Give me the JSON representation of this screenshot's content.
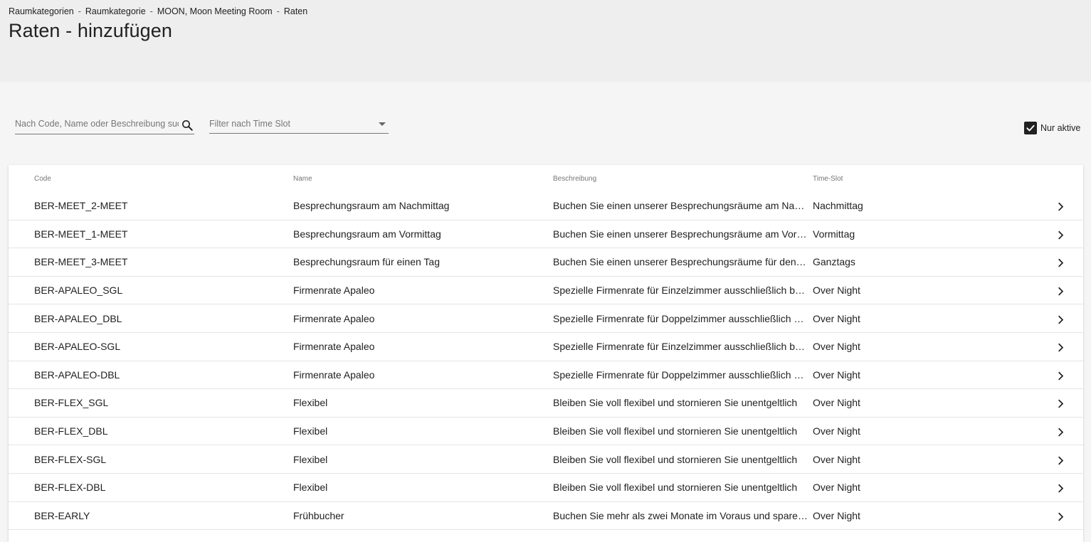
{
  "breadcrumb": [
    {
      "label": "Raumkategorien"
    },
    {
      "label": "Raumkategorie"
    },
    {
      "label": "MOON, Moon Meeting Room"
    },
    {
      "label": "Raten"
    }
  ],
  "breadcrumb_separator": "-",
  "page_title": "Raten - hinzufügen",
  "search": {
    "placeholder": "Nach Code, Name oder Beschreibung suchen",
    "value": ""
  },
  "filter": {
    "placeholder": "Filter nach Time Slot"
  },
  "active_filter": {
    "label": "Nur aktive",
    "checked": true
  },
  "table": {
    "columns": {
      "code": "Code",
      "name": "Name",
      "description": "Beschreibung",
      "time_slot": "Time-Slot"
    },
    "rows": [
      {
        "code": "BER-MEET_2-MEET",
        "name": "Besprechungsraum am Nachmittag",
        "description": "Buchen Sie einen unserer Besprechungsräume am Nachmittag",
        "time_slot": "Nachmittag"
      },
      {
        "code": "BER-MEET_1-MEET",
        "name": "Besprechungsraum am Vormittag",
        "description": "Buchen Sie einen unserer Besprechungsräume am Vormittag",
        "time_slot": "Vormittag"
      },
      {
        "code": "BER-MEET_3-MEET",
        "name": "Besprechungsraum für einen Tag",
        "description": "Buchen Sie einen unserer Besprechungsräume für den ganzen Tag",
        "time_slot": "Ganztags"
      },
      {
        "code": "BER-APALEO_SGL",
        "name": "Firmenrate Apaleo",
        "description": "Spezielle Firmenrate für Einzelzimmer ausschließlich buchbar",
        "time_slot": "Over Night"
      },
      {
        "code": "BER-APALEO_DBL",
        "name": "Firmenrate Apaleo",
        "description": "Spezielle Firmenrate für Doppelzimmer ausschließlich buchbar",
        "time_slot": "Over Night"
      },
      {
        "code": "BER-APALEO-SGL",
        "name": "Firmenrate Apaleo",
        "description": "Spezielle Firmenrate für Einzelzimmer ausschließlich buchbar",
        "time_slot": "Over Night"
      },
      {
        "code": "BER-APALEO-DBL",
        "name": "Firmenrate Apaleo",
        "description": "Spezielle Firmenrate für Doppelzimmer ausschließlich buchbar",
        "time_slot": "Over Night"
      },
      {
        "code": "BER-FLEX_SGL",
        "name": "Flexibel",
        "description": "Bleiben Sie voll flexibel und stornieren Sie unentgeltlich",
        "time_slot": "Over Night"
      },
      {
        "code": "BER-FLEX_DBL",
        "name": "Flexibel",
        "description": "Bleiben Sie voll flexibel und stornieren Sie unentgeltlich",
        "time_slot": "Over Night"
      },
      {
        "code": "BER-FLEX-SGL",
        "name": "Flexibel",
        "description": "Bleiben Sie voll flexibel und stornieren Sie unentgeltlich",
        "time_slot": "Over Night"
      },
      {
        "code": "BER-FLEX-DBL",
        "name": "Flexibel",
        "description": "Bleiben Sie voll flexibel und stornieren Sie unentgeltlich",
        "time_slot": "Over Night"
      },
      {
        "code": "BER-EARLY",
        "name": "Frühbucher",
        "description": "Buchen Sie mehr als zwei Monate im Voraus und sparen Sie",
        "time_slot": "Over Night"
      }
    ]
  }
}
